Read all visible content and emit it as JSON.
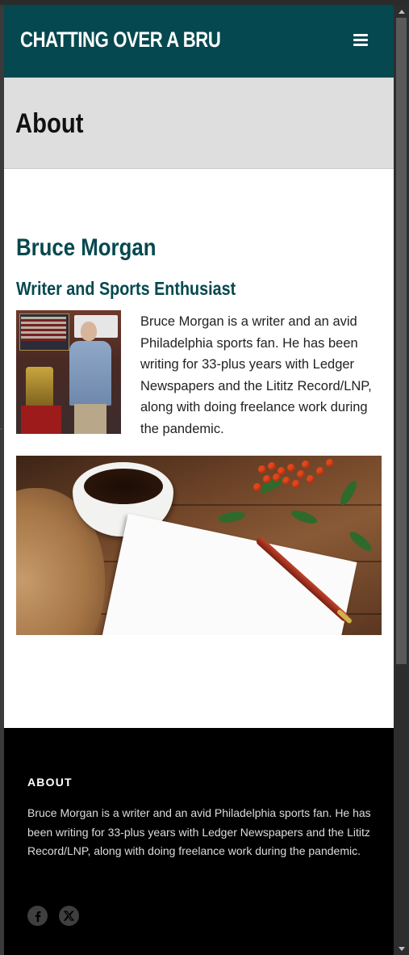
{
  "header": {
    "site_title": "CHATTING OVER A BRU",
    "menu_icon": "hamburger-menu-icon"
  },
  "page": {
    "title": "About"
  },
  "profile": {
    "name": "Bruce Morgan",
    "role": "Writer and Sports Enthusiast",
    "bio": "Bruce Morgan is a writer and an avid Philadelphia sports fan. He has been writing for 33-plus years with Ledger Newspapers and the Lititz Record/LNP, along with doing freelance work during the pandemic."
  },
  "footer": {
    "heading": "ABOUT",
    "text": "Bruce Morgan is a writer and an avid Philadelphia sports fan. He has been writing for 33-plus years with Ledger Newspapers and the Lititz Record/LNP, along with doing freelance work during the pandemic.",
    "social": [
      {
        "icon": "facebook-icon"
      },
      {
        "icon": "x-twitter-icon"
      }
    ]
  },
  "colors": {
    "brand": "#05484f",
    "title_band": "#dedede",
    "footer_bg": "#000000"
  }
}
